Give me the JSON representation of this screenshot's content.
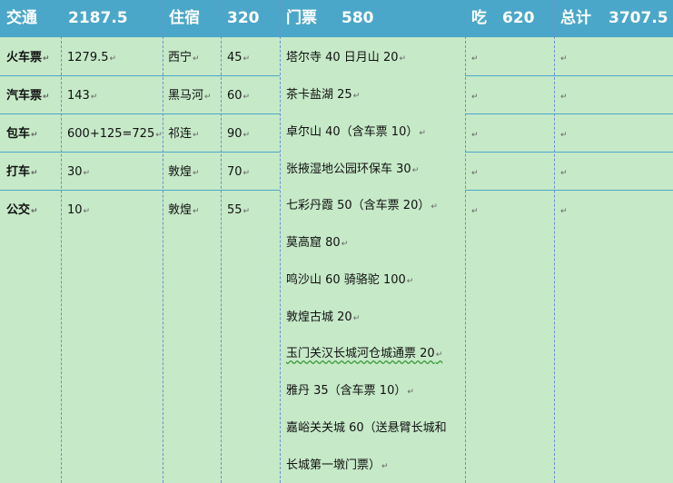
{
  "header": {
    "transport_label": "交通",
    "transport_total": "2187.5",
    "lodging_label": "住宿",
    "lodging_total": "320",
    "tickets_label": "门票",
    "tickets_total": "580",
    "food_label": "吃",
    "food_total": "620",
    "sum_label": "总计",
    "sum_total": "3707.5"
  },
  "transport": [
    {
      "type": "火车票",
      "amount": "1279.5"
    },
    {
      "type": "汽车票",
      "amount": "143"
    },
    {
      "type": "包车",
      "amount": "600+125=725"
    },
    {
      "type": "打车",
      "amount": "30"
    },
    {
      "type": "公交",
      "amount": "10"
    }
  ],
  "lodging": [
    {
      "place": "西宁",
      "amount": "45"
    },
    {
      "place": "黑马河",
      "amount": "60"
    },
    {
      "place": "祁连",
      "amount": "90"
    },
    {
      "place": "敦煌",
      "amount": "70"
    },
    {
      "place": "敦煌",
      "amount": "55"
    }
  ],
  "tickets": [
    "塔尔寺 40 日月山 20",
    "茶卡盐湖 25",
    "卓尔山 40（含车票 10）",
    "张掖湿地公园环保车 30",
    "七彩丹霞 50（含车票 20）",
    "莫高窟 80",
    "鸣沙山 60 骑骆驼 100",
    "敦煌古城 20",
    "玉门关汉长城河仓城通票 20",
    "雅丹 35（含车票 10）",
    "嘉峪关关城  60（送悬臂长城和",
    "长城第一墩门票）"
  ],
  "marks": {
    "cell_end": "↵"
  }
}
